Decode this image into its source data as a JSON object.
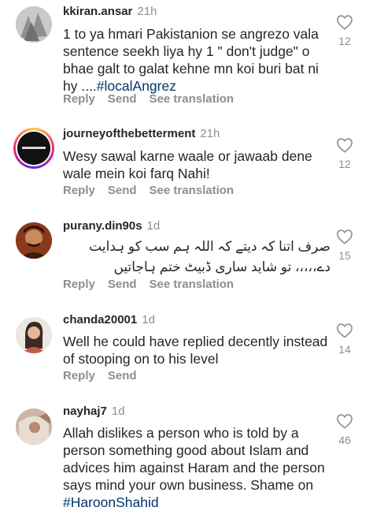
{
  "actions": {
    "reply": "Reply",
    "send": "Send",
    "see_translation": "See translation"
  },
  "comments": [
    {
      "username": "kkiran.ansar",
      "time": "21h",
      "text": "1 to ya hmari Pakistanion se angrezo vala sentence seekh liya hy 1 \" don't judge\" o bhae galt to galat kehne mn koi buri bat ni hy ....",
      "hashtag": "#localAngrez",
      "likes": "12",
      "has_translation": true
    },
    {
      "username": "journeyofthebetterment",
      "time": "21h",
      "text": "Wesy sawal karne waale or jawaab dene wale mein koi farq Nahi!",
      "likes": "12",
      "has_translation": true
    },
    {
      "username": "purany.din90s",
      "time": "1d",
      "text": "صرف اتنا کہ دیتے کہ اللہ ہم سب کو ہدایت دے،،،،، تو شاید ساری ڈبیٹ ختم ہاجاتیں",
      "likes": "15",
      "has_translation": true
    },
    {
      "username": "chanda20001",
      "time": "1d",
      "text": "Well he could have replied decently instead of stooping on to his level",
      "likes": "14",
      "has_translation": false
    },
    {
      "username": "nayhaj7",
      "time": "1d",
      "text": "Allah dislikes a person who is told by a person something good about Islam and advices him against Haram and the person says mind your own business. Shame on",
      "hashtag": "#HaroonShahid",
      "likes": "46",
      "has_translation": false
    }
  ]
}
